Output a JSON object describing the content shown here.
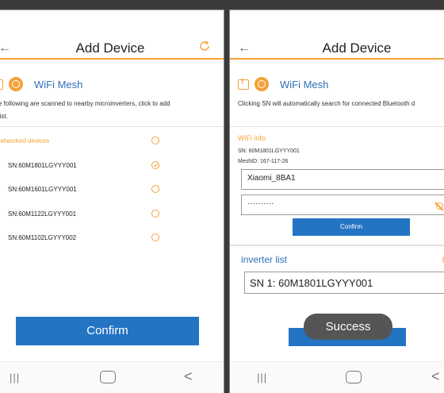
{
  "left": {
    "header": {
      "title": "Add Device",
      "back_icon": "arrow-left-icon",
      "refresh_icon": "refresh-icon"
    },
    "mesh": {
      "label": "WiFi Mesh"
    },
    "description_line1": "e following are scanned to nearby microinverters, click to add",
    "description_line2": "list.",
    "section_label": "networked devices",
    "devices": [
      {
        "sn": "SN:60M1801LGYYY001",
        "checked": true
      },
      {
        "sn": "SN:60M1601LGYYY001",
        "checked": false
      },
      {
        "sn": "SN:60M1122LGYYY001",
        "checked": false
      },
      {
        "sn": "SN:60M1102LGYYY002",
        "checked": false
      }
    ],
    "confirm_label": "Confirm",
    "nav": {
      "recent": "|||",
      "back": "<"
    }
  },
  "right": {
    "header": {
      "title": "Add Device",
      "back_icon": "arrow-left-icon"
    },
    "mesh": {
      "label": "WiFi Mesh"
    },
    "description": "Clicking SN will automatically search for connected Bluetooth d",
    "wifi_info": {
      "label": "WiFi info",
      "sn": "SN: 60M1801LGYYY001",
      "mesh_id": "MeshID: 167-117-26",
      "ssid_value": "Xiaomi_8BA1",
      "password_value": "··········",
      "confirm_label": "Confirm"
    },
    "inverter_list": {
      "title": "inverter list",
      "item": "SN 1: 60M1801LGYYY001"
    },
    "toast": "Success",
    "nav": {
      "recent": "|||",
      "back": "<"
    }
  },
  "colors": {
    "accent": "#f5a23a",
    "primary": "#2474c4",
    "link": "#2e6fb5"
  }
}
